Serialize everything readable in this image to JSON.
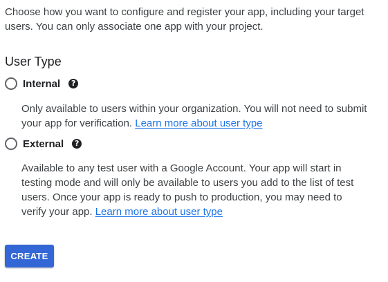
{
  "intro": "Choose how you want to configure and register your app, including your target users. You can only associate one app with your project.",
  "user_type": {
    "title": "User Type",
    "options": [
      {
        "label": "Internal",
        "selected": false,
        "help_icon": "question-circle-icon",
        "description": "Only available to users within your organization. You will not need to submit your app for verification.",
        "link": "Learn more about user type"
      },
      {
        "label": "External",
        "selected": false,
        "help_icon": "question-circle-icon",
        "description": "Available to any test user with a Google Account. Your app will start in testing mode and will only be available to users you add to the list of test users. Once your app is ready to push to production, you may need to verify your app.",
        "link": "Learn more about user type"
      }
    ]
  },
  "actions": {
    "create_label": "CREATE"
  },
  "colors": {
    "primary_button": "#3367d6",
    "link": "#1a73e8",
    "text": "#3c4043"
  }
}
